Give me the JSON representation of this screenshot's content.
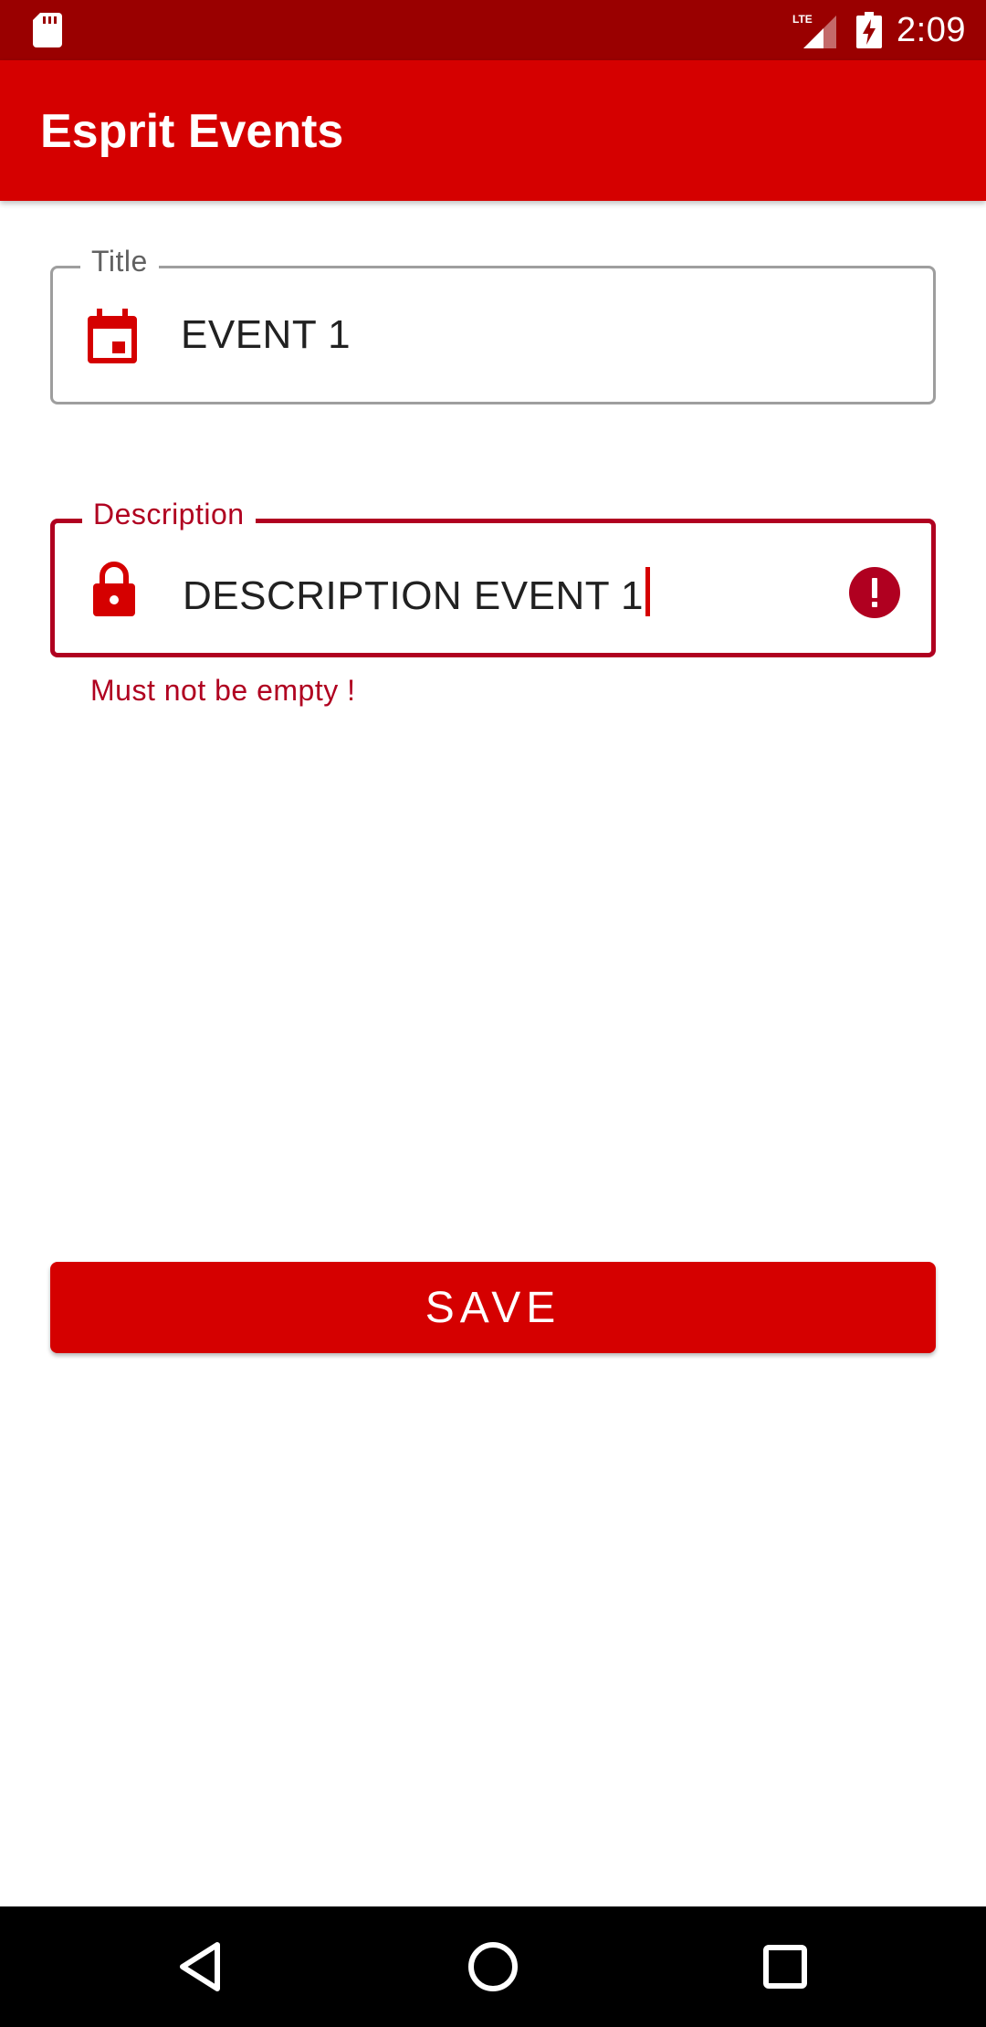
{
  "status_bar": {
    "time": "2:09",
    "network_label": "LTE",
    "icons": [
      "sd-card-icon",
      "lte-signal-icon",
      "battery-charging-icon"
    ]
  },
  "app_bar": {
    "title": "Esprit Events"
  },
  "form": {
    "title_field": {
      "label": "Title",
      "value": "EVENT 1",
      "icon": "calendar-icon"
    },
    "description_field": {
      "label": "Description",
      "value": "DESCRIPTION EVENT 1",
      "icon": "lock-icon",
      "error_icon": "error-icon",
      "helper_text": "Must not be empty !"
    },
    "save_label": "SAVE"
  },
  "nav_bar": {
    "buttons": [
      "back-icon",
      "home-icon",
      "recents-icon"
    ]
  },
  "colors": {
    "status_bar": "#9a0000",
    "primary": "#d50000",
    "error": "#b00020",
    "outline": "#9e9e9e",
    "text": "#212121"
  }
}
